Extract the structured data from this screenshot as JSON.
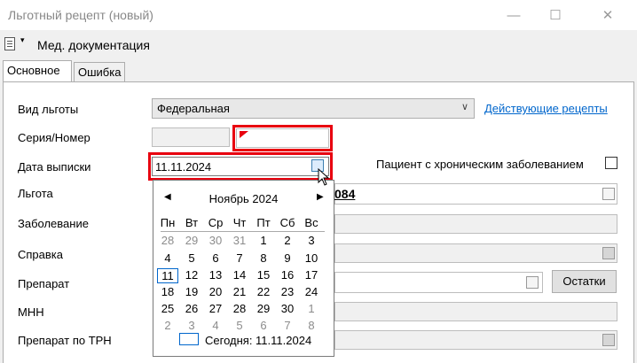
{
  "window": {
    "title": "Льготный рецепт (новый)",
    "minimize": "—",
    "maximize": "☐",
    "close": "✕"
  },
  "toolbar": {
    "menu_label": "Мед. документация",
    "arrow": "▾"
  },
  "tabs": [
    {
      "label": "Основное"
    },
    {
      "label": "Ошибка"
    }
  ],
  "form": {
    "labels": {
      "benefit_type": "Вид льготы",
      "series_number": "Серия/Номер",
      "issue_date": "Дата выписки",
      "benefit": "Льгота",
      "disease": "Заболевание",
      "certificate": "Справка",
      "drug": "Препарат",
      "inn": "МНН",
      "drug_trn": "Препарат по ТРН"
    },
    "benefit_type_value": "Федеральная",
    "active_prescriptions_link": "Действующие рецепты",
    "issue_date_value": "11.11.2024",
    "chronic_patient_label": "Пациент с хроническим заболеванием",
    "benefit_partial_value": "084",
    "remains_button": "Остатки"
  },
  "calendar": {
    "month_label": "Ноябрь 2024",
    "prev": "◀",
    "next": "▶",
    "weekdays": [
      "Пн",
      "Вт",
      "Ср",
      "Чт",
      "Пт",
      "Сб",
      "Вс"
    ],
    "weeks": [
      [
        "28",
        "29",
        "30",
        "31",
        "1",
        "2",
        "3"
      ],
      [
        "4",
        "5",
        "6",
        "7",
        "8",
        "9",
        "10"
      ],
      [
        "11",
        "12",
        "13",
        "14",
        "15",
        "16",
        "17"
      ],
      [
        "18",
        "19",
        "20",
        "21",
        "22",
        "23",
        "24"
      ],
      [
        "25",
        "26",
        "27",
        "28",
        "29",
        "30",
        "1"
      ],
      [
        "2",
        "3",
        "4",
        "5",
        "6",
        "7",
        "8"
      ]
    ],
    "selected_day": "11",
    "today_label": "Сегодня: 11.11.2024"
  }
}
